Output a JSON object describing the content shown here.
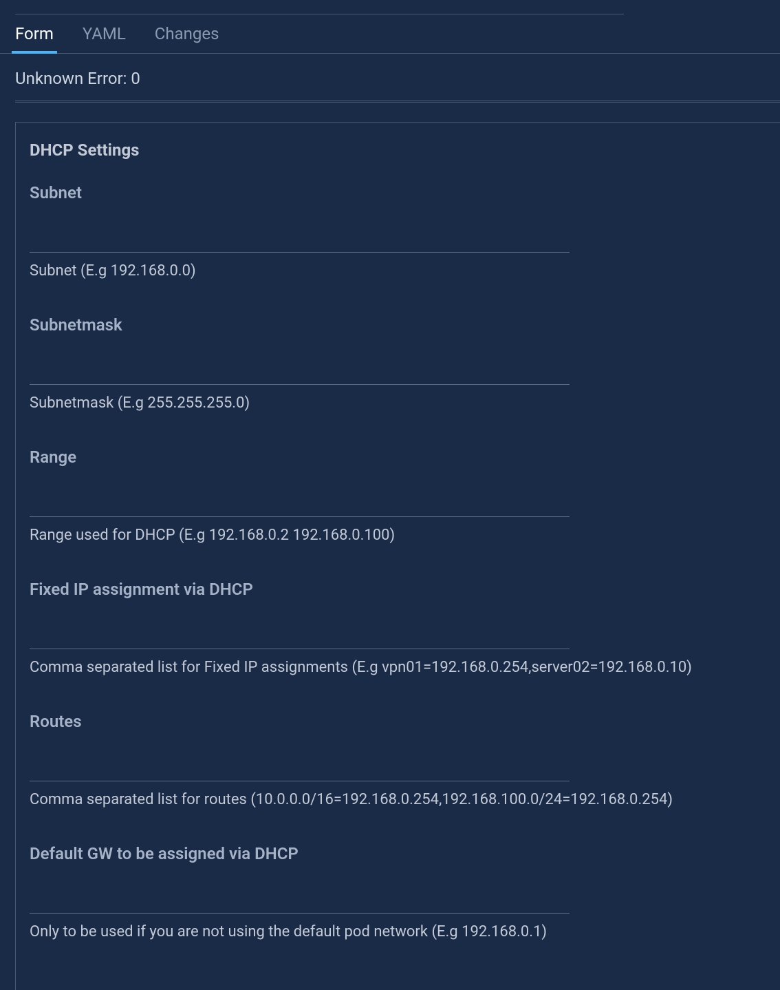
{
  "tabs": {
    "form": "Form",
    "yaml": "YAML",
    "changes": "Changes"
  },
  "error_message": "Unknown Error: 0",
  "panel": {
    "title": "DHCP Settings",
    "fields": {
      "subnet": {
        "label": "Subnet",
        "value": "",
        "help": "Subnet (E.g 192.168.0.0)"
      },
      "subnetmask": {
        "label": "Subnetmask",
        "value": "",
        "help": "Subnetmask (E.g 255.255.255.0)"
      },
      "range": {
        "label": "Range",
        "value": "",
        "help": "Range used for DHCP (E.g 192.168.0.2 192.168.0.100)"
      },
      "fixed_ip": {
        "label": "Fixed IP assignment via DHCP",
        "value": "",
        "help": "Comma separated list for Fixed IP assignments (E.g vpn01=192.168.0.254,server02=192.168.0.10)"
      },
      "routes": {
        "label": "Routes",
        "value": "",
        "help": "Comma separated list for routes (10.0.0.0/16=192.168.0.254,192.168.100.0/24=192.168.0.254)"
      },
      "default_gw": {
        "label": "Default GW to be assigned via DHCP",
        "value": "",
        "help": "Only to be used if you are not using the default pod network (E.g 192.168.0.1)"
      }
    }
  }
}
